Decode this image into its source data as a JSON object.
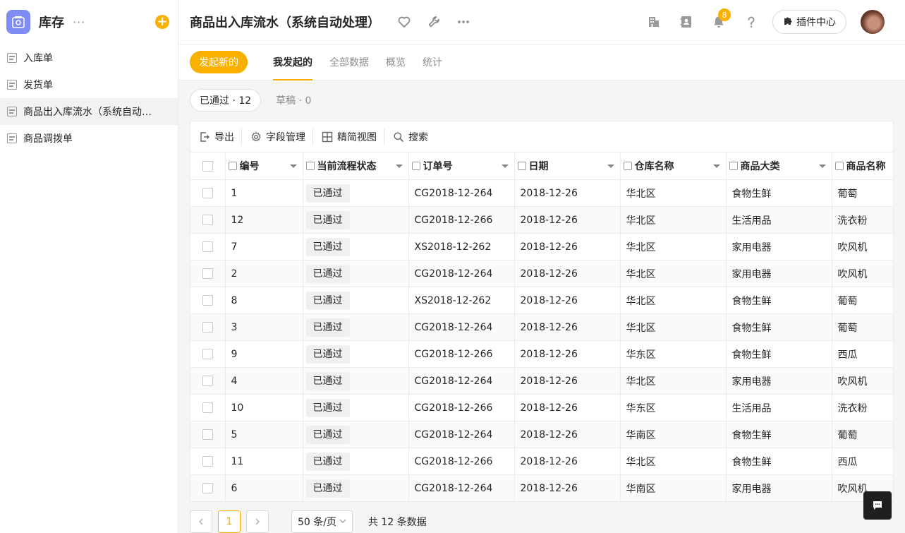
{
  "app": {
    "name": "库存",
    "more": "···",
    "add": "+"
  },
  "sidebar": {
    "items": [
      {
        "label": "入库单"
      },
      {
        "label": "发货单"
      },
      {
        "label": "商品出入库流水（系统自动处理）",
        "active": true
      },
      {
        "label": "商品调拨单"
      }
    ]
  },
  "header": {
    "title": "商品出入库流水（系统自动处理）",
    "notification_count": "8",
    "plugin_label": "插件中心"
  },
  "tabs": {
    "start_label": "发起新的",
    "items": [
      {
        "label": "我发起的",
        "active": true
      },
      {
        "label": "全部数据"
      },
      {
        "label": "概览"
      },
      {
        "label": "统计"
      }
    ]
  },
  "filters": {
    "approved": "已通过 · 12",
    "draft": "草稿 · 0"
  },
  "toolbar": {
    "export": "导出",
    "fields": "字段管理",
    "compact": "精简视图",
    "search": "搜索"
  },
  "table": {
    "headers": [
      "编号",
      "当前流程状态",
      "订单号",
      "日期",
      "仓库名称",
      "商品大类",
      "商品名称"
    ],
    "rows": [
      [
        "1",
        "已通过",
        "CG2018-12-264",
        "2018-12-26",
        "华北区",
        "食物生鲜",
        "葡萄"
      ],
      [
        "12",
        "已通过",
        "CG2018-12-266",
        "2018-12-26",
        "华北区",
        "生活用品",
        "洗衣粉"
      ],
      [
        "7",
        "已通过",
        "XS2018-12-262",
        "2018-12-26",
        "华北区",
        "家用电器",
        "吹风机"
      ],
      [
        "2",
        "已通过",
        "CG2018-12-264",
        "2018-12-26",
        "华北区",
        "家用电器",
        "吹风机"
      ],
      [
        "8",
        "已通过",
        "XS2018-12-262",
        "2018-12-26",
        "华北区",
        "食物生鲜",
        "葡萄"
      ],
      [
        "3",
        "已通过",
        "CG2018-12-264",
        "2018-12-26",
        "华北区",
        "食物生鲜",
        "葡萄"
      ],
      [
        "9",
        "已通过",
        "CG2018-12-266",
        "2018-12-26",
        "华东区",
        "食物生鲜",
        "西瓜"
      ],
      [
        "4",
        "已通过",
        "CG2018-12-264",
        "2018-12-26",
        "华北区",
        "家用电器",
        "吹风机"
      ],
      [
        "10",
        "已通过",
        "CG2018-12-266",
        "2018-12-26",
        "华东区",
        "生活用品",
        "洗衣粉"
      ],
      [
        "5",
        "已通过",
        "CG2018-12-264",
        "2018-12-26",
        "华南区",
        "食物生鲜",
        "葡萄"
      ],
      [
        "11",
        "已通过",
        "CG2018-12-266",
        "2018-12-26",
        "华北区",
        "食物生鲜",
        "西瓜"
      ],
      [
        "6",
        "已通过",
        "CG2018-12-264",
        "2018-12-26",
        "华南区",
        "家用电器",
        "吹风机"
      ]
    ]
  },
  "pager": {
    "current_page": "1",
    "page_size": "50 条/页",
    "total": "共 12 条数据"
  },
  "colors": {
    "accent": "#f9b000",
    "logo": "#7f8cf4"
  }
}
